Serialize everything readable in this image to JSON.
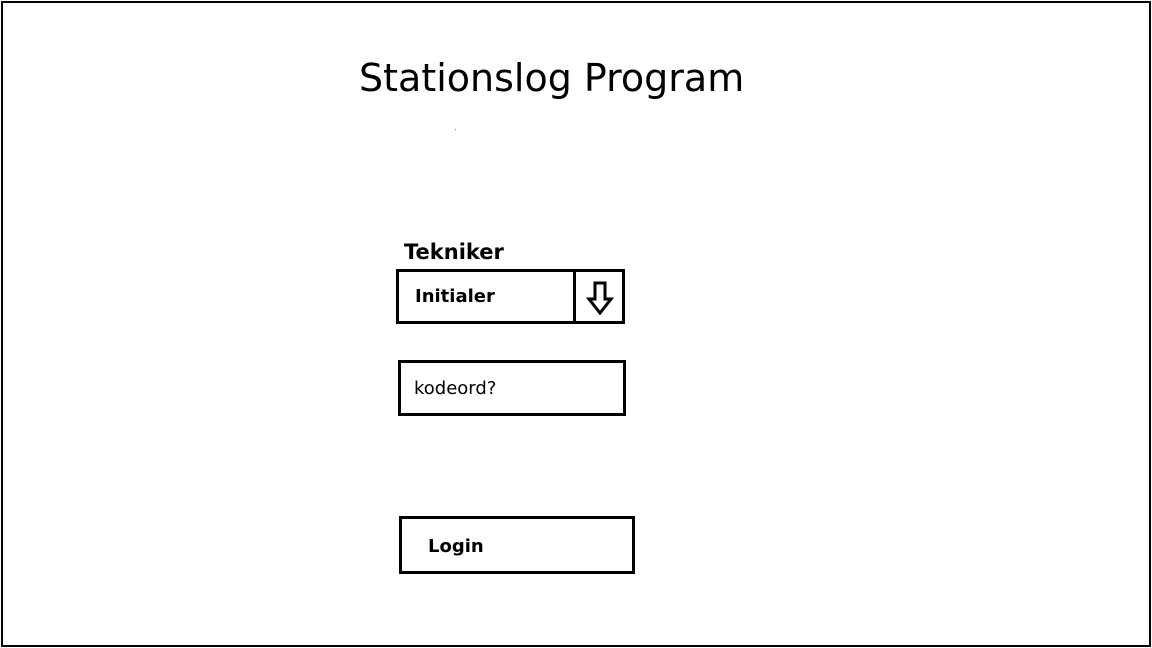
{
  "app": {
    "title": "Stationslog Program"
  },
  "technician": {
    "label": "Tekniker",
    "selected": "Initialer",
    "toggle_icon": "arrow-down-icon"
  },
  "password": {
    "placeholder": "kodeord?",
    "value": ""
  },
  "login": {
    "label": "Login"
  }
}
